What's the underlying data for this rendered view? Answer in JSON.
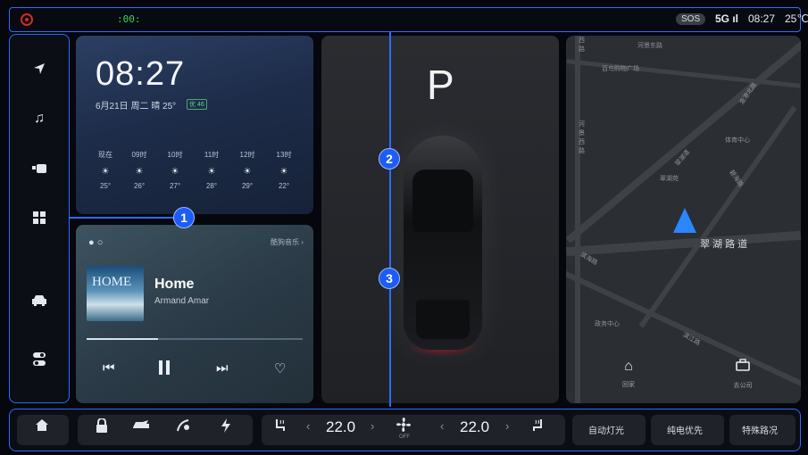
{
  "status": {
    "left_indicator": "(•)",
    "green_text": ":00:",
    "sos": "SOS",
    "network": "5G ıl",
    "time": "08:27",
    "temp": "25℃"
  },
  "sidebar": {
    "icons": [
      "navigation-icon",
      "music-icon",
      "camera-icon",
      "apps-grid-icon",
      "car-icon",
      "toggle-settings-icon"
    ]
  },
  "weather": {
    "clock": "08:27",
    "date_line": "6月21日 周二  晴 25°",
    "aqi": "优 46",
    "hours": [
      {
        "t": "现在",
        "temp": "25°"
      },
      {
        "t": "09时",
        "temp": "26°"
      },
      {
        "t": "10时",
        "temp": "27°"
      },
      {
        "t": "11时",
        "temp": "28°"
      },
      {
        "t": "12时",
        "temp": "29°"
      },
      {
        "t": "13时",
        "temp": "22°"
      }
    ]
  },
  "music": {
    "source": "●  ○",
    "more": "酷狗音乐 ›",
    "cover_text": "HOME",
    "title": "Home",
    "artist": "Armand Amar",
    "progress": 0.33
  },
  "car": {
    "gear": "P"
  },
  "map": {
    "labels": [
      "河景东路",
      "西",
      "路",
      "百鸟购物广场",
      "河景西路",
      "体育中心",
      "渔港北路",
      "翠湖道",
      "碧海路",
      "滨海路",
      "政务中心",
      "翠湖苑",
      "滨江路"
    ],
    "street": "翠 湖 路 道",
    "buttons": [
      {
        "icon": "home-icon",
        "label": "回家"
      },
      {
        "icon": "briefcase-icon",
        "label": "去公司"
      }
    ]
  },
  "bottom": {
    "left_temp": "22.0",
    "right_temp": "22.0",
    "fan_label": "OFF",
    "auto_light": "自动灯光",
    "ev_priority": "纯电优先",
    "special_road": "特殊路况"
  },
  "annotations": [
    "1",
    "2",
    "3"
  ]
}
